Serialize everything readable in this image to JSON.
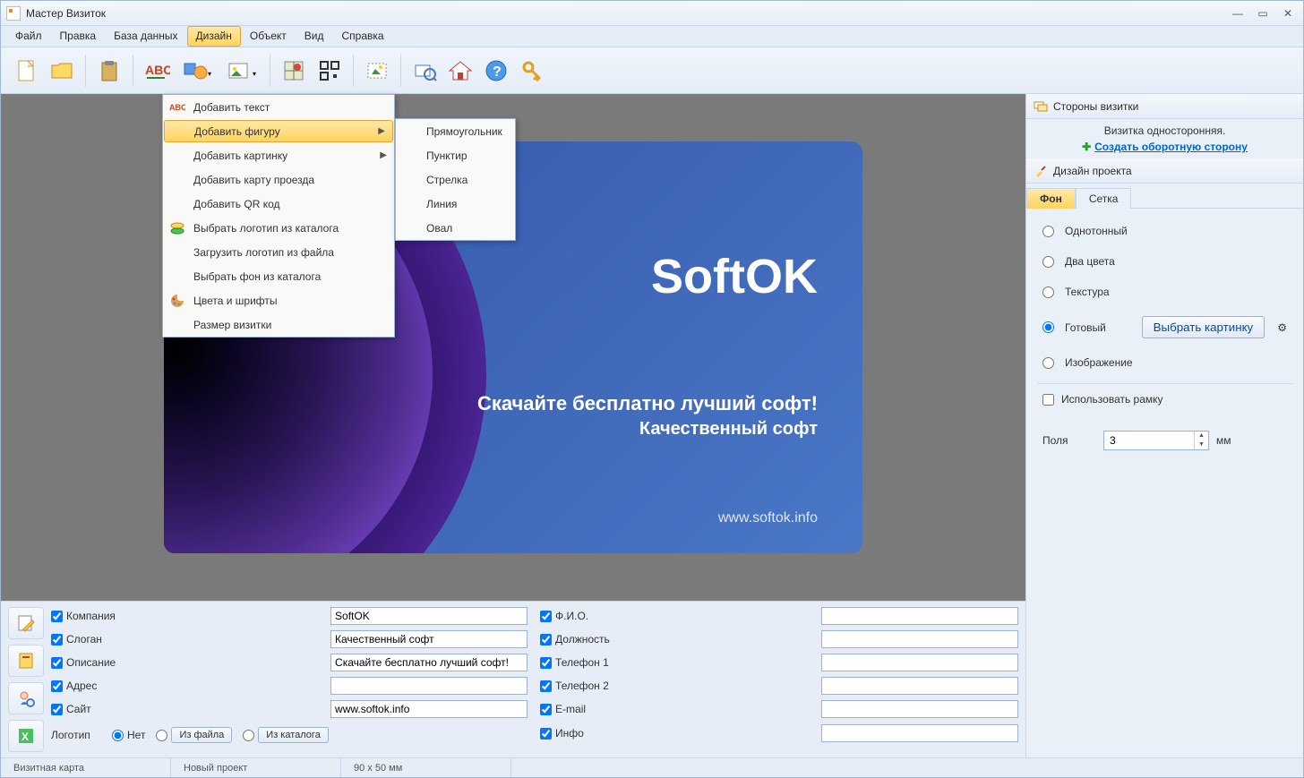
{
  "window": {
    "title": "Мастер Визиток"
  },
  "menubar": {
    "items": [
      "Файл",
      "Правка",
      "База данных",
      "Дизайн",
      "Объект",
      "Вид",
      "Справка"
    ],
    "active_index": 3
  },
  "dropdown": {
    "items": [
      {
        "label": "Добавить текст"
      },
      {
        "label": "Добавить фигуру",
        "has_sub": true,
        "highlight": true
      },
      {
        "label": "Добавить картинку",
        "has_sub": true
      },
      {
        "label": "Добавить карту проезда"
      },
      {
        "label": "Добавить QR код"
      },
      {
        "label": "Выбрать логотип из каталога"
      },
      {
        "label": "Загрузить логотип из файла"
      },
      {
        "label": "Выбрать фон из каталога"
      },
      {
        "label": "Цвета и шрифты"
      },
      {
        "label": "Размер визитки"
      }
    ],
    "sub_items": [
      "Прямоугольник",
      "Пунктир",
      "Стрелка",
      "Линия",
      "Овал"
    ]
  },
  "card": {
    "title": "SoftOK",
    "line1": "Скачайте бесплатно лучший софт!",
    "line2": "Качественный софт",
    "url": "www.softok.info"
  },
  "rightpanel": {
    "sides_header": "Стороны визитки",
    "side_info": "Визитка односторонняя.",
    "create_back": "Создать оборотную сторону",
    "design_header": "Дизайн проекта",
    "tabs": [
      "Фон",
      "Сетка"
    ],
    "bg_options": {
      "single": "Однотонный",
      "two": "Два цвета",
      "texture": "Текстура",
      "ready": "Готовый",
      "image": "Изображение"
    },
    "select_image_btn": "Выбрать картинку",
    "use_frame": "Использовать рамку",
    "margins_label": "Поля",
    "margins_value": "3",
    "margins_unit": "мм"
  },
  "bottom": {
    "labels": {
      "company": "Компания",
      "slogan": "Слоган",
      "desc": "Описание",
      "address": "Адрес",
      "site": "Сайт",
      "logo": "Логотип",
      "fio": "Ф.И.О.",
      "position": "Должность",
      "phone1": "Телефон 1",
      "phone2": "Телефон 2",
      "email": "E-mail",
      "info": "Инфо"
    },
    "values": {
      "company": "SoftOK",
      "slogan": "Качественный софт",
      "desc": "Скачайте бесплатно лучший софт!",
      "address": "",
      "site": "www.softok.info",
      "fio": "",
      "position": "",
      "phone1": "",
      "phone2": "",
      "email": "",
      "info": ""
    },
    "logo_opts": {
      "none": "Нет",
      "from_file": "Из файла",
      "from_catalog": "Из каталога"
    }
  },
  "statusbar": {
    "type": "Визитная карта",
    "project": "Новый проект",
    "size": "90 x 50 мм"
  }
}
